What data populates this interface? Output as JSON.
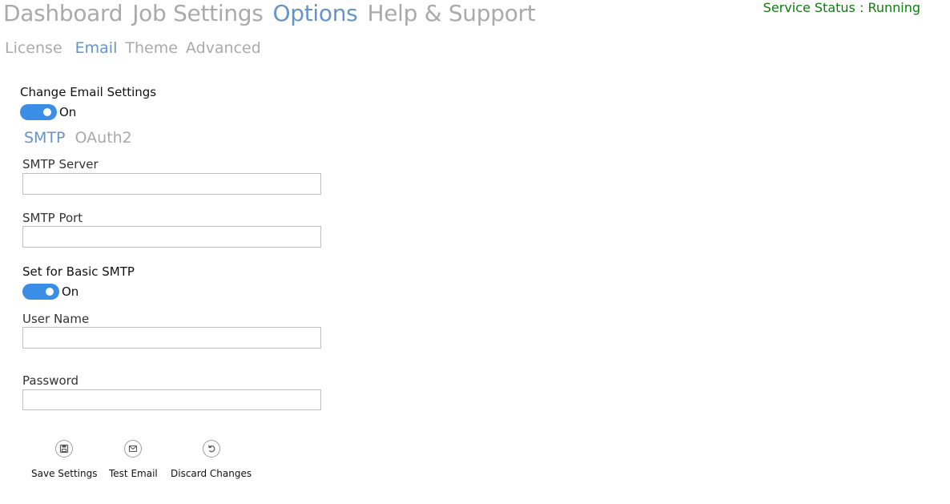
{
  "main_nav": {
    "items": [
      {
        "label": "Dashboard"
      },
      {
        "label": "Job Settings"
      },
      {
        "label": "Options"
      },
      {
        "label": "Help & Support"
      }
    ],
    "active": "Options"
  },
  "service_status": "Service Status : Running",
  "sub_nav": {
    "items": [
      {
        "label": "License"
      },
      {
        "label": "Email"
      },
      {
        "label": "Theme"
      },
      {
        "label": "Advanced"
      }
    ],
    "active": "Email"
  },
  "email_settings": {
    "change_label": "Change Email Settings",
    "change_toggle": {
      "state_label": "On",
      "on": true
    },
    "protocol_tabs": [
      {
        "label": "SMTP"
      },
      {
        "label": "OAuth2"
      }
    ],
    "active_protocol": "SMTP",
    "smtp_server": {
      "label": "SMTP Server",
      "value": ""
    },
    "smtp_port": {
      "label": "SMTP Port",
      "value": ""
    },
    "basic_smtp": {
      "label": "Set for Basic SMTP",
      "state_label": "On",
      "on": true
    },
    "user_name": {
      "label": "User Name",
      "value": ""
    },
    "password": {
      "label": "Password",
      "value": ""
    }
  },
  "actions": {
    "save": {
      "label": "Save Settings",
      "icon": "floppy-disk-icon"
    },
    "test": {
      "label": "Test Email",
      "icon": "envelope-icon"
    },
    "discard": {
      "label": "Discard Changes",
      "icon": "undo-icon"
    }
  },
  "colors": {
    "accent": "#6494c8",
    "inactive": "#aaaaaa",
    "toggle_on": "#3a8ee6",
    "status_running": "#107c10"
  }
}
